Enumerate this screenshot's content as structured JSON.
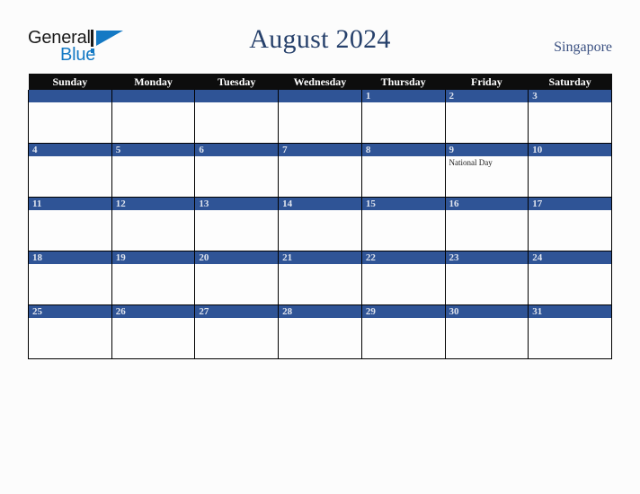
{
  "brand": {
    "name_part1": "General",
    "name_part2": "Blue",
    "logo_icon": "triangle-flag-icon",
    "color_blue": "#1479c4",
    "color_dark": "#1a1a1a"
  },
  "header": {
    "title": "August 2024",
    "locale": "Singapore",
    "title_color": "#26406b",
    "locale_color": "#3b5182"
  },
  "calendar": {
    "month": "August",
    "year": "2024",
    "header_bg": "#0d0d0d",
    "daynum_bg": "#2f5496",
    "daynum_color": "#dfe4ee",
    "weekdays": [
      "Sunday",
      "Monday",
      "Tuesday",
      "Wednesday",
      "Thursday",
      "Friday",
      "Saturday"
    ],
    "weeks": [
      [
        {
          "day": "",
          "events": []
        },
        {
          "day": "",
          "events": []
        },
        {
          "day": "",
          "events": []
        },
        {
          "day": "",
          "events": []
        },
        {
          "day": "1",
          "events": []
        },
        {
          "day": "2",
          "events": []
        },
        {
          "day": "3",
          "events": []
        }
      ],
      [
        {
          "day": "4",
          "events": []
        },
        {
          "day": "5",
          "events": []
        },
        {
          "day": "6",
          "events": []
        },
        {
          "day": "7",
          "events": []
        },
        {
          "day": "8",
          "events": []
        },
        {
          "day": "9",
          "events": [
            "National Day"
          ]
        },
        {
          "day": "10",
          "events": []
        }
      ],
      [
        {
          "day": "11",
          "events": []
        },
        {
          "day": "12",
          "events": []
        },
        {
          "day": "13",
          "events": []
        },
        {
          "day": "14",
          "events": []
        },
        {
          "day": "15",
          "events": []
        },
        {
          "day": "16",
          "events": []
        },
        {
          "day": "17",
          "events": []
        }
      ],
      [
        {
          "day": "18",
          "events": []
        },
        {
          "day": "19",
          "events": []
        },
        {
          "day": "20",
          "events": []
        },
        {
          "day": "21",
          "events": []
        },
        {
          "day": "22",
          "events": []
        },
        {
          "day": "23",
          "events": []
        },
        {
          "day": "24",
          "events": []
        }
      ],
      [
        {
          "day": "25",
          "events": []
        },
        {
          "day": "26",
          "events": []
        },
        {
          "day": "27",
          "events": []
        },
        {
          "day": "28",
          "events": []
        },
        {
          "day": "29",
          "events": []
        },
        {
          "day": "30",
          "events": []
        },
        {
          "day": "31",
          "events": []
        }
      ]
    ]
  }
}
